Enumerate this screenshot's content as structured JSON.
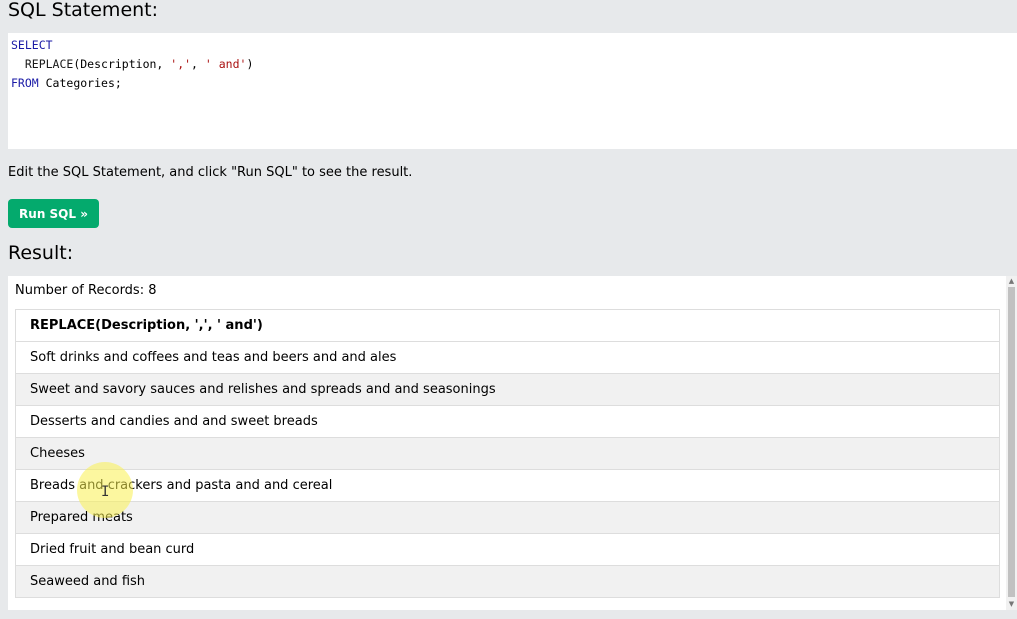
{
  "sql_section": {
    "heading": "SQL Statement:",
    "code": {
      "line1_kw": "SELECT",
      "line2_fn": "REPLACE",
      "line2_args_prefix": "(Description, ",
      "line2_str1": "','",
      "line2_sep": ", ",
      "line2_str2": "' and'",
      "line2_close": ")",
      "line3_kw": "FROM",
      "line3_rest": " Categories;"
    }
  },
  "instruction": "Edit the SQL Statement, and click \"Run SQL\" to see the result.",
  "run_button": {
    "label": "Run SQL »",
    "color": "#04aa6d"
  },
  "result_section": {
    "heading": "Result:",
    "record_count_text": "Number of Records: 8",
    "table": {
      "header": "REPLACE(Description, ',', ' and')",
      "rows": [
        "Soft drinks and coffees and teas and beers and and ales",
        "Sweet and savory sauces and relishes and spreads and and seasonings",
        "Desserts and candies and and sweet breads",
        "Cheeses",
        "Breads and crackers and pasta and and cereal",
        "Prepared meats",
        "Dried fruit and bean curd",
        "Seaweed and fish"
      ]
    }
  },
  "icons": {
    "scroll_up": "scroll-up-arrow-icon",
    "scroll_down": "scroll-down-arrow-icon",
    "text_cursor": "text-cursor-icon"
  }
}
